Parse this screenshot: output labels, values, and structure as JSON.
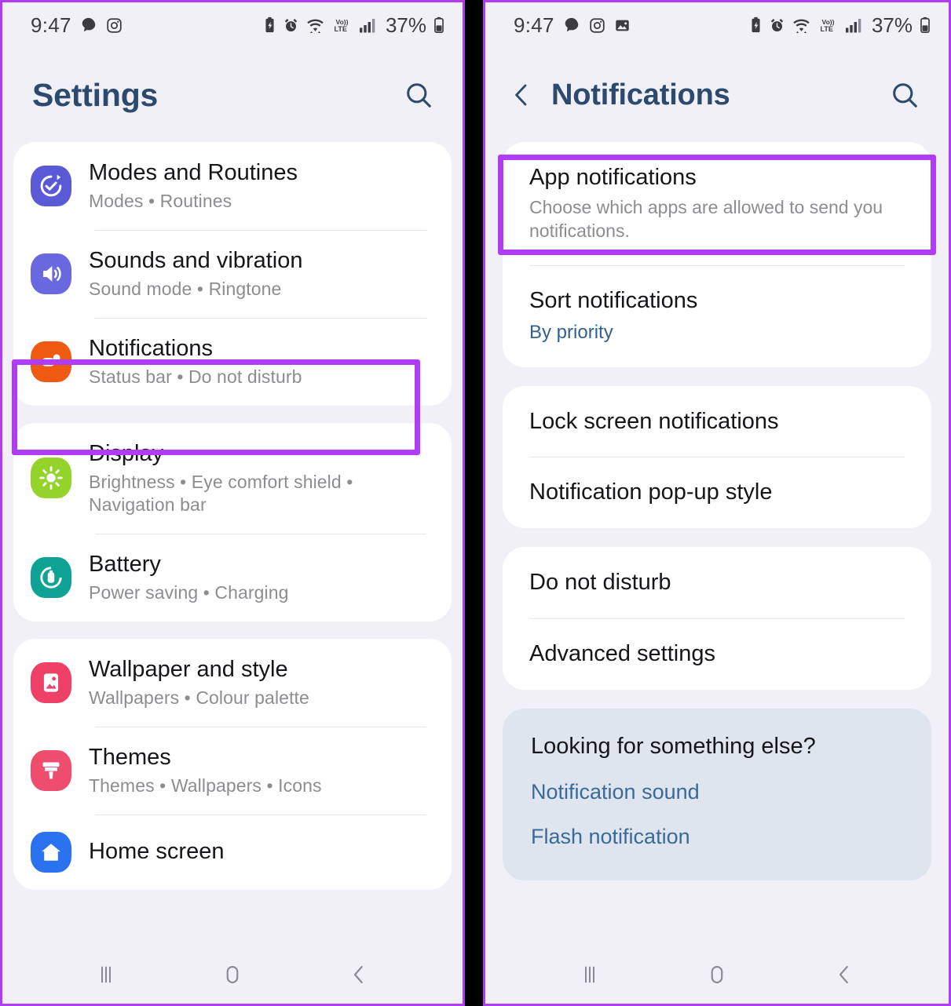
{
  "meta": {
    "accent_purple": "#b03cf5",
    "title_blue": "#2c4a6e",
    "link_blue": "#3a6a9a",
    "value_blue": "#33618e"
  },
  "left_phone": {
    "status_bar": {
      "time": "9:47",
      "left_icons": [
        "chat-bubble-icon",
        "instagram-icon"
      ],
      "right_icons": [
        "battery-saver-icon",
        "alarm-icon",
        "wifi-icon",
        "volte-icon",
        "signal-bars-icon"
      ],
      "battery_percent": "37%"
    },
    "header": {
      "title": "Settings",
      "search_icon": "search-icon"
    },
    "groups": [
      {
        "items": [
          {
            "icon": "modes-routines-icon",
            "icon_color": "#5a5ad6",
            "title": "Modes and Routines",
            "subtitle": "Modes  •  Routines"
          },
          {
            "icon": "sound-icon",
            "icon_color": "#6a68e0",
            "title": "Sounds and vibration",
            "subtitle": "Sound mode  •  Ringtone"
          },
          {
            "icon": "notifications-icon",
            "icon_color": "#ef5a10",
            "title": "Notifications",
            "subtitle": "Status bar  •  Do not disturb",
            "highlighted": true
          }
        ]
      },
      {
        "items": [
          {
            "icon": "display-brightness-icon",
            "icon_color": "#93d32a",
            "title": "Display",
            "subtitle": "Brightness  •  Eye comfort shield  •  Navigation bar"
          },
          {
            "icon": "battery-icon",
            "icon_color": "#0fa396",
            "title": "Battery",
            "subtitle": "Power saving  •  Charging"
          }
        ]
      },
      {
        "items": [
          {
            "icon": "wallpaper-icon",
            "icon_color": "#ef4068",
            "title": "Wallpaper and style",
            "subtitle": "Wallpapers  •  Colour palette"
          },
          {
            "icon": "themes-brush-icon",
            "icon_color": "#ee4d6e",
            "title": "Themes",
            "subtitle": "Themes  •  Wallpapers  •  Icons"
          },
          {
            "icon": "home-screen-icon",
            "icon_color": "#2a72f0",
            "title": "Home screen",
            "subtitle": ""
          }
        ]
      }
    ],
    "nav_bar": {
      "recents": "recents-icon",
      "home": "home-icon",
      "back": "back-icon"
    }
  },
  "right_phone": {
    "status_bar": {
      "time": "9:47",
      "left_icons": [
        "chat-bubble-icon",
        "instagram-icon",
        "photo-icon"
      ],
      "right_icons": [
        "battery-saver-icon",
        "alarm-icon",
        "wifi-icon",
        "volte-icon",
        "signal-bars-icon"
      ],
      "battery_percent": "37%"
    },
    "header": {
      "back_icon": "back-chevron-icon",
      "title": "Notifications",
      "search_icon": "search-icon"
    },
    "groups": [
      {
        "rows": [
          {
            "title": "App notifications",
            "desc": "Choose which apps are allowed to send you notifications.",
            "highlighted": true
          },
          {
            "title": "Sort notifications",
            "value": "By priority"
          }
        ]
      },
      {
        "rows": [
          {
            "title": "Lock screen notifications"
          },
          {
            "title": "Notification pop-up style"
          }
        ]
      },
      {
        "rows": [
          {
            "title": "Do not disturb"
          },
          {
            "title": "Advanced settings"
          }
        ]
      }
    ],
    "info_card": {
      "title": "Looking for something else?",
      "links": [
        "Notification sound",
        "Flash notification"
      ]
    },
    "nav_bar": {
      "recents": "recents-icon",
      "home": "home-icon",
      "back": "back-icon"
    }
  }
}
